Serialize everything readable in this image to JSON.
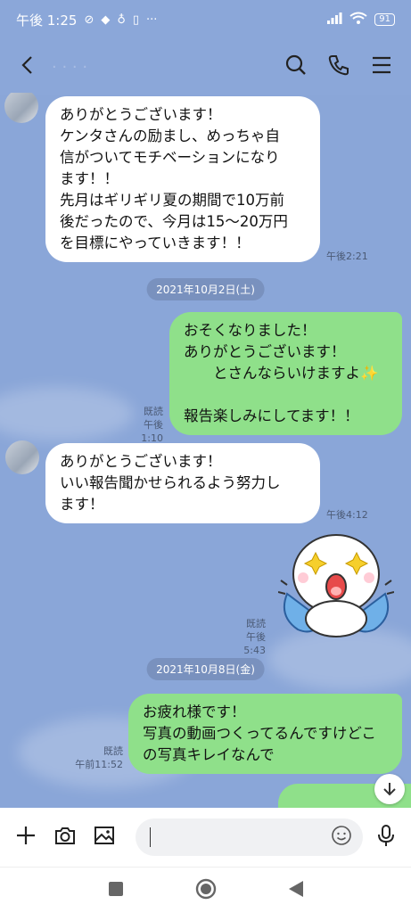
{
  "status": {
    "time": "午後 1:25",
    "battery": "91"
  },
  "header": {
    "contact_name": "· · · ·"
  },
  "messages": [
    {
      "side": "in",
      "text": "ありがとうございます！\nケンタさんの励まし、めっちゃ自\n信がついてモチベーションになり\nます！！\n先月はギリギリ夏の期間で10万前\n後だったので、今月は15〜20万円\nを目標にやっていきます！！",
      "time": "午後2:21"
    },
    {
      "side": "date",
      "text": "2021年10月2日(土)"
    },
    {
      "side": "out",
      "text": "おそくなりました！\nありがとうございます！\n　　とさんならいけますよ✨\n\n報告楽しみにしてます！！",
      "read": "既読",
      "time": "午後1:10"
    },
    {
      "side": "in",
      "text": "ありがとうございます！\nいい報告聞かせられるよう努力し\nます！",
      "time": "午後4:12"
    },
    {
      "side": "sticker",
      "read": "既読",
      "time": "午後5:43"
    },
    {
      "side": "date",
      "text": "2021年10月8日(金)"
    },
    {
      "side": "out",
      "text": "お疲れ様です！\n写真の動画つくってるんですけどこ\nの写真キレイなんで",
      "read": "既読",
      "time": "午前11:52"
    }
  ],
  "input": {
    "placeholder": "",
    "value": ""
  },
  "colors": {
    "background": "#8aa6d8",
    "outgoing_bubble": "#8fe08a",
    "incoming_bubble": "#ffffff"
  }
}
